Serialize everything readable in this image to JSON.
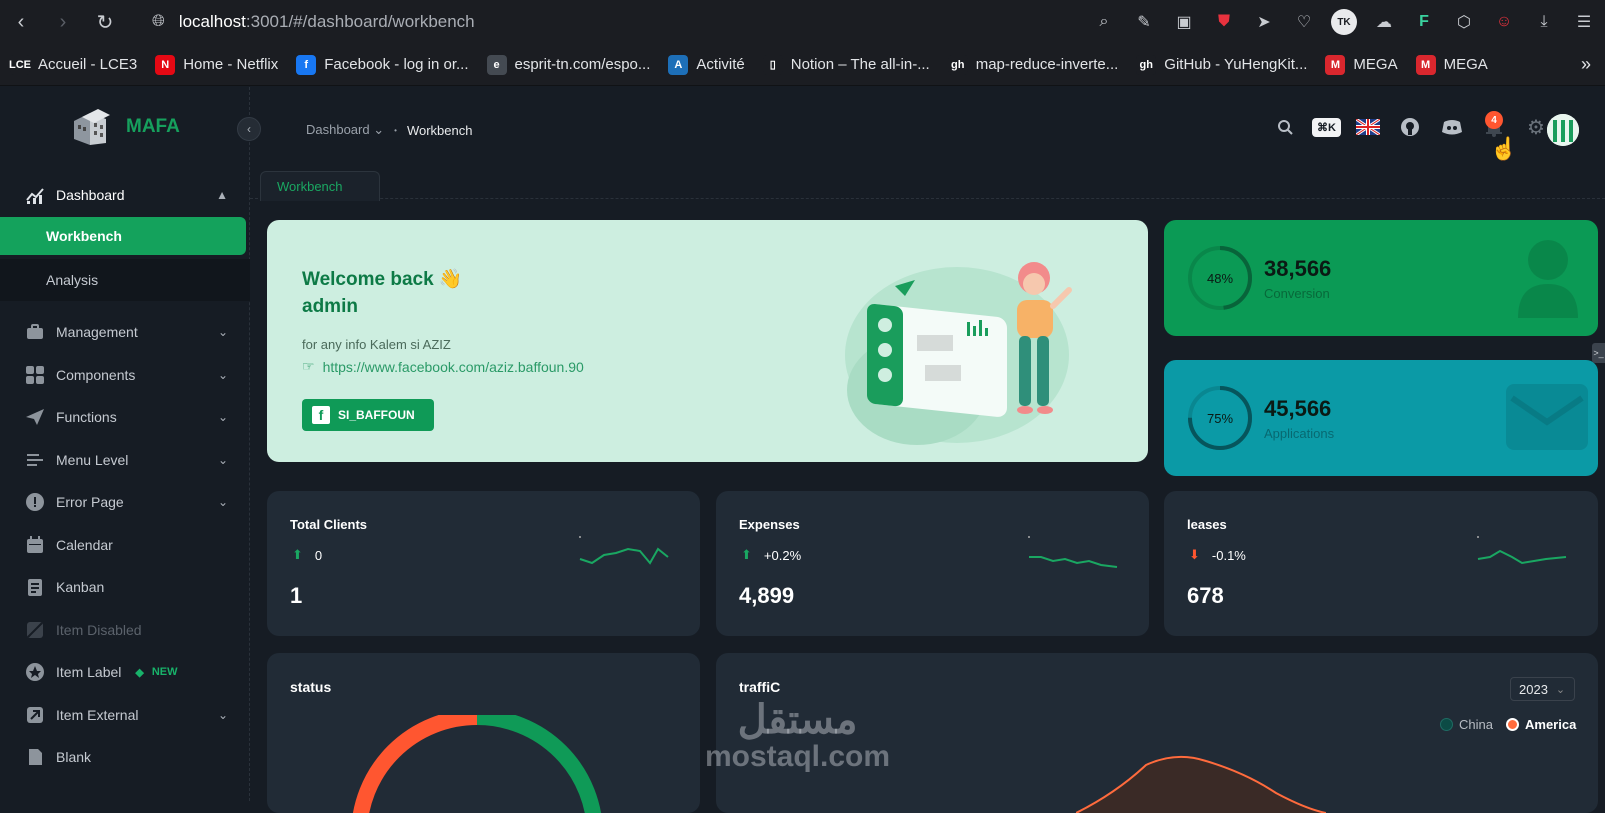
{
  "browser": {
    "host": "localhost",
    "path": ":3001/#/dashboard/workbench",
    "bookmarks": [
      {
        "icon": "LCE",
        "label": "Accueil - LCE3",
        "color": "#1b1d22"
      },
      {
        "icon": "N",
        "label": "Home - Netflix",
        "color": "#e50914"
      },
      {
        "icon": "f",
        "label": "Facebook - log in or...",
        "color": "#1877f2"
      },
      {
        "icon": "e",
        "label": "esprit-tn.com/espo...",
        "color": "#444a52"
      },
      {
        "icon": "A",
        "label": "Activité",
        "color": "#1d6fb8"
      },
      {
        "icon": "▯",
        "label": "Notion – The all-in-...",
        "color": "#1b1d22"
      },
      {
        "icon": "gh",
        "label": "map-reduce-inverte...",
        "color": "#1b1d22"
      },
      {
        "icon": "gh",
        "label": "GitHub - YuHengKit...",
        "color": "#1b1d22"
      },
      {
        "icon": "M",
        "label": "MEGA",
        "color": "#d9272e"
      },
      {
        "icon": "M",
        "label": "MEGA",
        "color": "#d9272e"
      }
    ]
  },
  "app": {
    "logo": "MAFA",
    "breadcrumb": {
      "parent": "Dashboard",
      "current": "Workbench"
    },
    "tab": "Workbench",
    "notifications": "4",
    "search_shortcut": "⌘K"
  },
  "sidebar": {
    "dashboard": "Dashboard",
    "workbench": "Workbench",
    "analysis": "Analysis",
    "items": [
      {
        "label": "Management"
      },
      {
        "label": "Components"
      },
      {
        "label": "Functions"
      },
      {
        "label": "Menu Level"
      },
      {
        "label": "Error Page"
      },
      {
        "label": "Calendar"
      },
      {
        "label": "Kanban"
      },
      {
        "label": "Item Disabled"
      },
      {
        "label": "Item Label"
      },
      {
        "label": "Item External"
      },
      {
        "label": "Blank"
      }
    ],
    "new_label": "NEW"
  },
  "welcome": {
    "line1": "Welcome back 👋",
    "line2": "admin",
    "info": "for any info Kalem si AZIZ",
    "link": "https://www.facebook.com/aziz.baffoun.90",
    "button": "SI_BAFFOUN"
  },
  "stats": {
    "conversion": {
      "percent": "48%",
      "value": "38,566",
      "label": "Conversion",
      "fraction": 0.48,
      "color": "#0b9a55"
    },
    "applications": {
      "percent": "75%",
      "value": "45,566",
      "label": "Applications",
      "fraction": 0.75,
      "color": "#0b9aa6"
    }
  },
  "small_cards": [
    {
      "title": "Total Clients",
      "pct": "0",
      "value": "1",
      "trend": "up"
    },
    {
      "title": "Expenses",
      "pct": "+0.2%",
      "value": "4,899",
      "trend": "up"
    },
    {
      "title": "leases",
      "pct": "-0.1%",
      "value": "678",
      "trend": "down"
    }
  ],
  "status_card": {
    "title": "status"
  },
  "traffic": {
    "title": "traffiC",
    "year": "2023",
    "legend": [
      {
        "label": "China",
        "color": "#0c4b45"
      },
      {
        "label": "America",
        "color": "#ff6b3d"
      }
    ]
  },
  "watermark": {
    "line1": "مستقل",
    "line2": "mostaql.com"
  }
}
